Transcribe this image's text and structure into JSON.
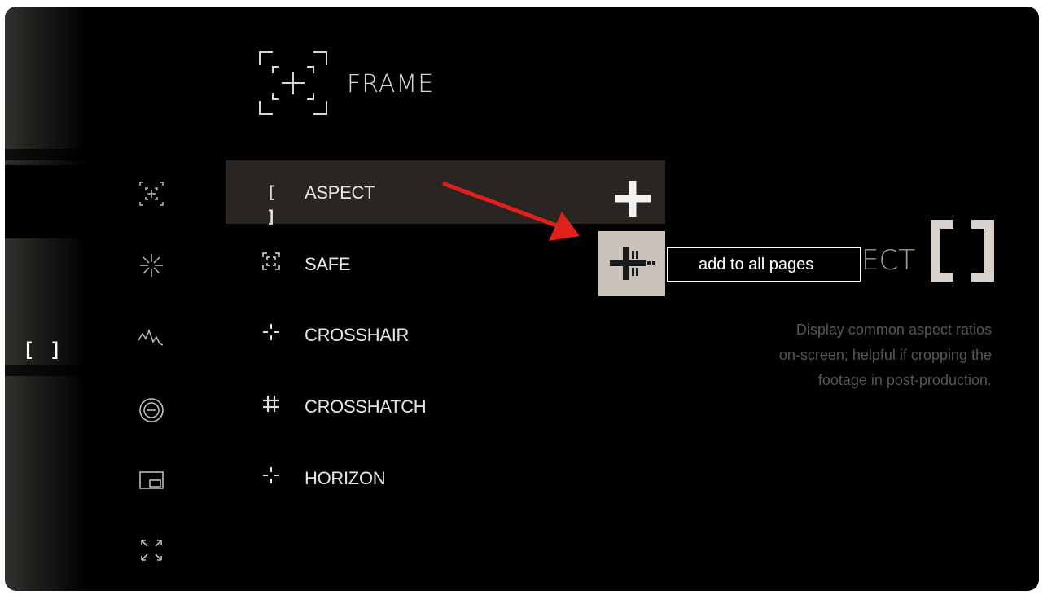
{
  "header": {
    "title": "FRAME",
    "icon": "frame-icon"
  },
  "page_indicator": {
    "label": "[ ]",
    "icon": "aspect-bracket-icon"
  },
  "side_nav": [
    {
      "icon": "frame-icon",
      "glyph": "⌜+⌟"
    },
    {
      "icon": "exposure-icon",
      "glyph": "✳"
    },
    {
      "icon": "waveform-icon",
      "glyph": "⩘"
    },
    {
      "icon": "focus-icon",
      "glyph": "⊖"
    },
    {
      "icon": "pip-icon",
      "glyph": "▭"
    },
    {
      "icon": "fullscreen-icon",
      "glyph": "⤢"
    }
  ],
  "menu": [
    {
      "label": "ASPECT",
      "icon": "aspect-icon",
      "glyph": "[ ]",
      "selected": true
    },
    {
      "label": "SAFE",
      "icon": "safe-icon",
      "glyph": "⁞⁞"
    },
    {
      "label": "CROSSHAIR",
      "icon": "crosshair-icon",
      "glyph": "-¦-"
    },
    {
      "label": "CROSSHATCH",
      "icon": "crosshatch-icon",
      "glyph": "#"
    },
    {
      "label": "HORIZON",
      "icon": "horizon-icon",
      "glyph": "-¦-"
    }
  ],
  "actions": {
    "add_icon": "plus-icon",
    "add_all_icon": "add-to-all-icon",
    "tooltip": "add to all pages"
  },
  "detail": {
    "title_partial": "ECT",
    "icon": "aspect-bracket-icon",
    "description": [
      "Display common aspect ratios",
      "on-screen; helpful if cropping the",
      "footage in post-production."
    ]
  },
  "colors": {
    "accent_arrow": "#e0201c",
    "selected_row": "#2a2521",
    "button_bg": "#c9c2bb"
  }
}
